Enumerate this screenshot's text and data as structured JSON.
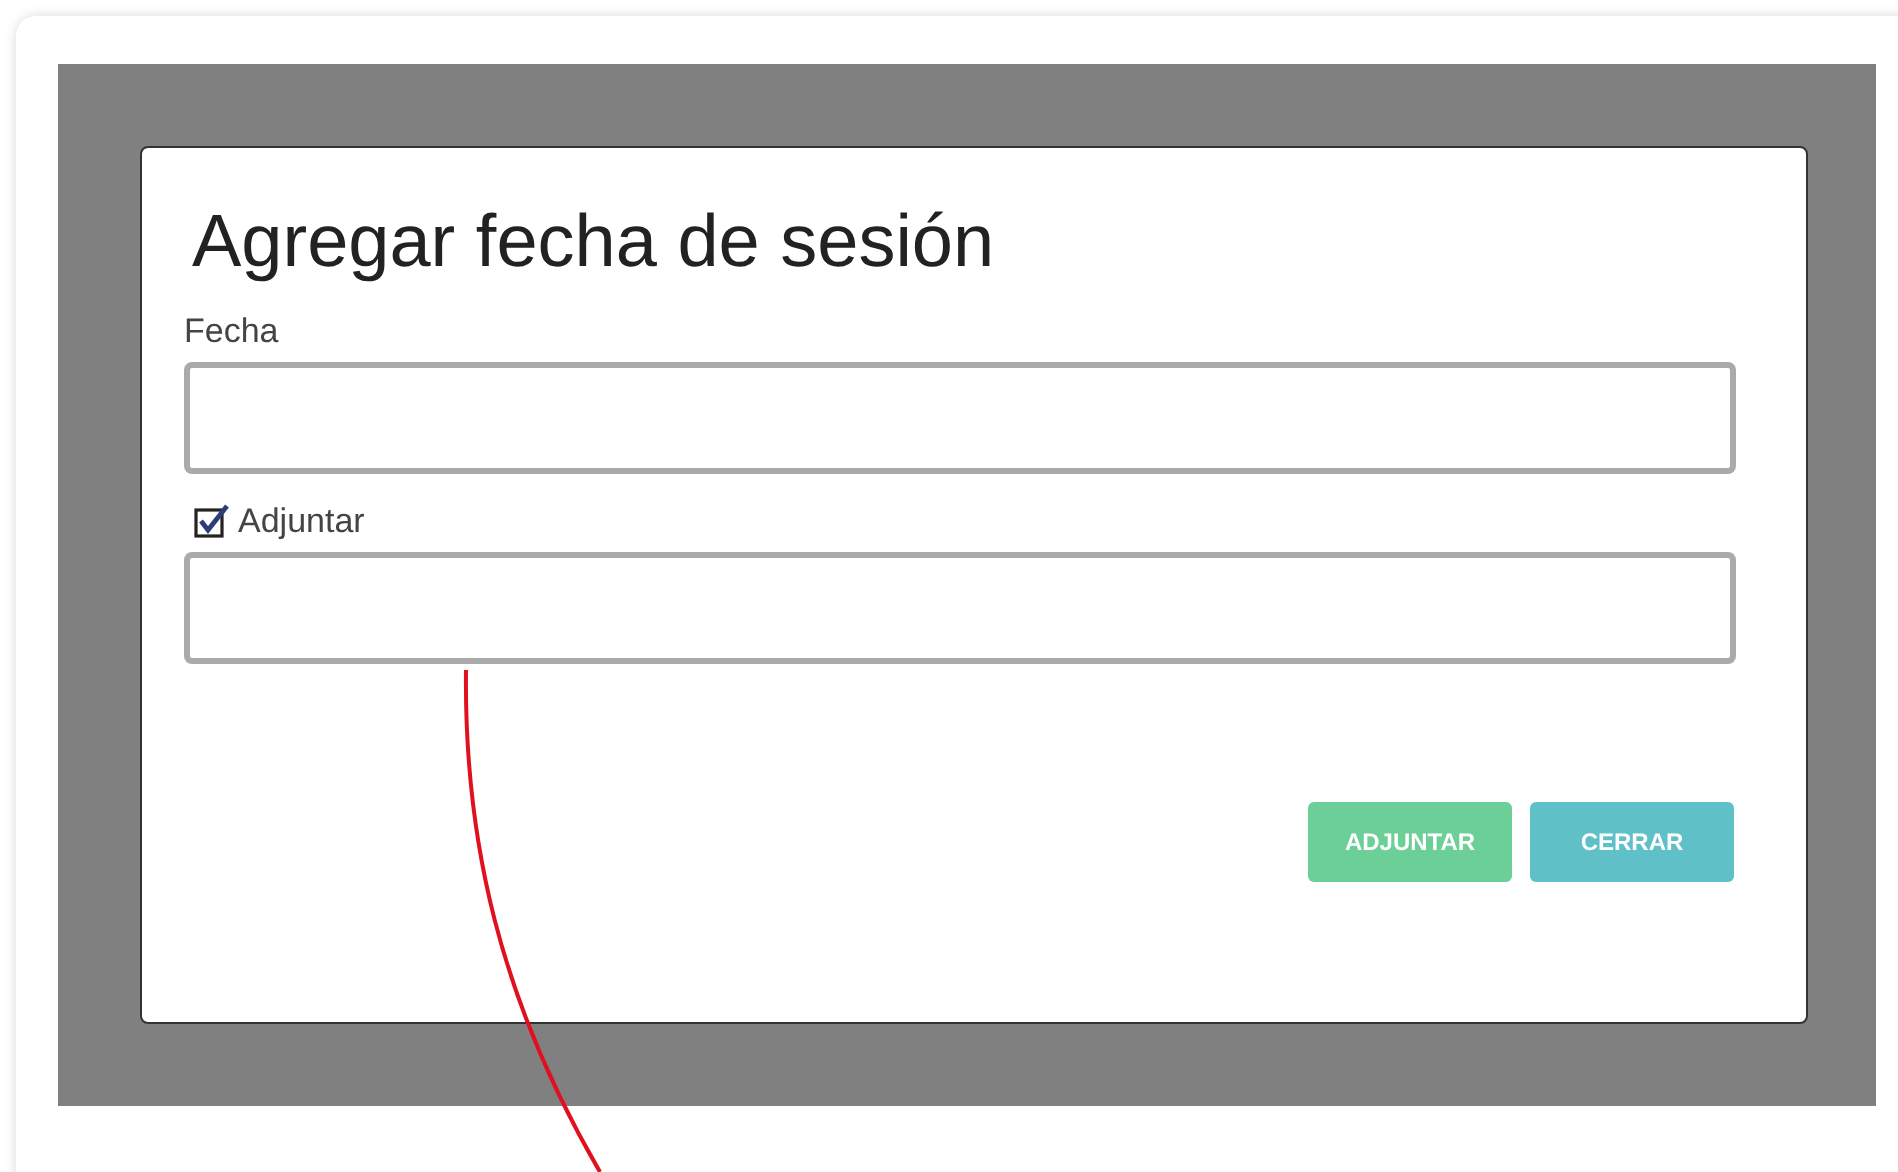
{
  "dialog": {
    "title": "Agregar fecha de sesión",
    "fields": [
      {
        "kind": "labeled",
        "label": "Fecha"
      },
      {
        "kind": "checkbox",
        "label": "Adjuntar",
        "checked": true
      }
    ],
    "buttons": [
      {
        "label": "ADJUNTAR",
        "color": "#6dcf98"
      },
      {
        "label": "CERRAR",
        "color": "#5fc0c7"
      }
    ]
  }
}
